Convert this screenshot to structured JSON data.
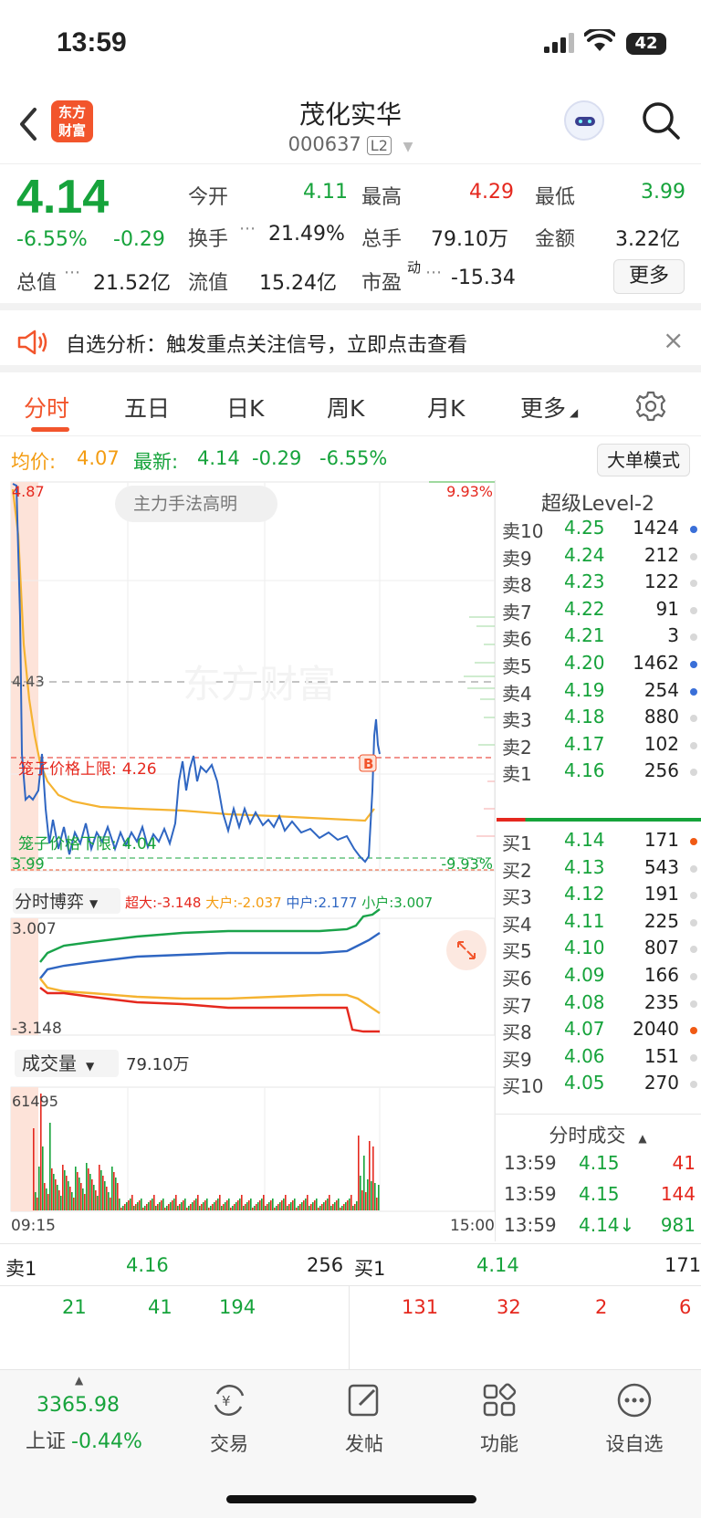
{
  "status_bar": {
    "time": "13:59",
    "battery": "42"
  },
  "header": {
    "logo_line1": "东方",
    "logo_line2": "财富",
    "title": "茂化实华",
    "code": "000637",
    "level_badge": "L2"
  },
  "quote": {
    "price": "4.14",
    "change_pct": "-6.55%",
    "change": "-0.29",
    "open_label": "今开",
    "open": "4.11",
    "high_label": "最高",
    "high": "4.29",
    "low_label": "最低",
    "low": "3.99",
    "turnover_label": "换手",
    "turnover": "21.49%",
    "volume_label": "总手",
    "volume": "79.10万",
    "amount_label": "金额",
    "amount": "3.22亿",
    "mktcap_label": "总值",
    "mktcap": "21.52亿",
    "float_label": "流值",
    "float": "15.24亿",
    "pe_label": "市盈",
    "pe_sup": "动",
    "pe": "-15.34",
    "more_button": "更多"
  },
  "notice": {
    "text": "自选分析：触发重点关注信号，立即点击查看"
  },
  "tabs": [
    "分时",
    "五日",
    "日K",
    "周K",
    "月K",
    "更多"
  ],
  "summary": {
    "avg_label": "均价:",
    "avg": "4.07",
    "latest_label": "最新:",
    "latest": "4.14",
    "change": "-0.29",
    "change_pct": "-6.55%",
    "mode_button": "大单模式"
  },
  "chart": {
    "price_top": "4.87",
    "price_mid": "4.43",
    "price_bot": "3.99",
    "pct_top": "9.93%",
    "pct_bot": "-9.93%",
    "overlay_tag": "主力手法高明",
    "watermark": "东方财富",
    "upper_limit_label": "笼子价格上限:",
    "upper_limit": "4.26",
    "lower_limit_label": "笼子价格下限:",
    "lower_limit": "4.04",
    "b_marker": "B",
    "game_title": "分时博弈",
    "game_super_label": "超大:",
    "game_super": "-3.148",
    "game_large_label": "大户:",
    "game_large": "-2.037",
    "game_mid_label": "中户:",
    "game_mid": "2.177",
    "game_small_label": "小户:",
    "game_small": "3.007",
    "game_top": "3.007",
    "game_bot": "-3.148",
    "vol_title": "成交量",
    "vol_total": "79.10万",
    "vol_max": "61495",
    "time_start": "09:15",
    "time_end": "15:00"
  },
  "chart_data": {
    "type": "line",
    "price_range": [
      3.99,
      4.87
    ],
    "prev_close": 4.43,
    "avg_price": 4.07,
    "latest_price": 4.14
  },
  "orderbook": {
    "title": "超级Level-2",
    "sells": [
      {
        "label": "卖10",
        "price": "4.25",
        "vol": "1424",
        "dot": "#3a6fd8"
      },
      {
        "label": "卖9",
        "price": "4.24",
        "vol": "212",
        "dot": "#d8d8d8"
      },
      {
        "label": "卖8",
        "price": "4.23",
        "vol": "122",
        "dot": "#d8d8d8"
      },
      {
        "label": "卖7",
        "price": "4.22",
        "vol": "91",
        "dot": "#d8d8d8"
      },
      {
        "label": "卖6",
        "price": "4.21",
        "vol": "3",
        "dot": "#d8d8d8"
      },
      {
        "label": "卖5",
        "price": "4.20",
        "vol": "1462",
        "dot": "#3a6fd8"
      },
      {
        "label": "卖4",
        "price": "4.19",
        "vol": "254",
        "dot": "#3a6fd8"
      },
      {
        "label": "卖3",
        "price": "4.18",
        "vol": "880",
        "dot": "#d8d8d8"
      },
      {
        "label": "卖2",
        "price": "4.17",
        "vol": "102",
        "dot": "#d8d8d8"
      },
      {
        "label": "卖1",
        "price": "4.16",
        "vol": "256",
        "dot": "#d8d8d8"
      }
    ],
    "buys": [
      {
        "label": "买1",
        "price": "4.14",
        "vol": "171",
        "dot": "#f05a14"
      },
      {
        "label": "买2",
        "price": "4.13",
        "vol": "543",
        "dot": "#d8d8d8"
      },
      {
        "label": "买3",
        "price": "4.12",
        "vol": "191",
        "dot": "#d8d8d8"
      },
      {
        "label": "买4",
        "price": "4.11",
        "vol": "225",
        "dot": "#d8d8d8"
      },
      {
        "label": "买5",
        "price": "4.10",
        "vol": "807",
        "dot": "#d8d8d8"
      },
      {
        "label": "买6",
        "price": "4.09",
        "vol": "166",
        "dot": "#d8d8d8"
      },
      {
        "label": "买7",
        "price": "4.08",
        "vol": "235",
        "dot": "#d8d8d8"
      },
      {
        "label": "买8",
        "price": "4.07",
        "vol": "2040",
        "dot": "#f05a14"
      },
      {
        "label": "买9",
        "price": "4.06",
        "vol": "151",
        "dot": "#d8d8d8"
      },
      {
        "label": "买10",
        "price": "4.05",
        "vol": "270",
        "dot": "#d8d8d8"
      }
    ],
    "ticks_title": "分时成交",
    "ticks": [
      {
        "time": "13:59",
        "price": "4.15",
        "vol": "41",
        "vcolor": "#e5281e"
      },
      {
        "time": "13:59",
        "price": "4.15",
        "vol": "144",
        "vcolor": "#e5281e"
      },
      {
        "time": "13:59",
        "price": "4.14↓",
        "vol": "981",
        "vcolor": "#16a33b"
      }
    ]
  },
  "bottom_quote": {
    "sell_label": "卖1",
    "sell_price": "4.16",
    "sell_vol": "256",
    "buy_label": "买1",
    "buy_price": "4.14",
    "buy_vol": "171",
    "sell_queue": [
      "21",
      "41",
      "194"
    ],
    "buy_queue": [
      "131",
      "32",
      "2",
      "6"
    ]
  },
  "nav": {
    "index_value": "3365.98",
    "index_name": "上证",
    "index_change": "-0.44%",
    "items": [
      "交易",
      "发帖",
      "功能",
      "设自选"
    ]
  }
}
